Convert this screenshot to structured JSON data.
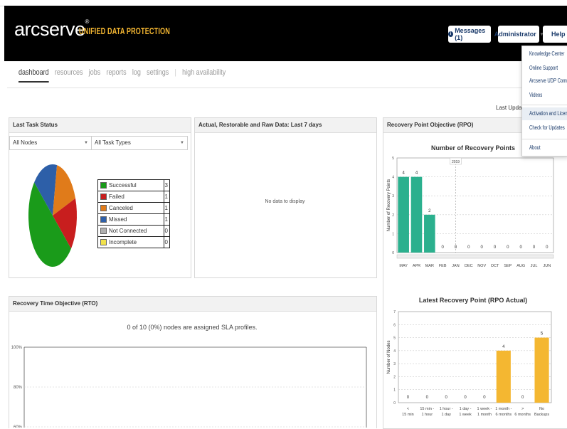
{
  "brand": {
    "logo": "arcserve",
    "reg": "®",
    "subtitle": "UNIFIED DATA PROTECTION"
  },
  "header": {
    "messages": "Messages (1)",
    "messages_icon": "info-icon",
    "admin": "Administrator",
    "help": "Help"
  },
  "nav": {
    "items": [
      "dashboard",
      "resources",
      "jobs",
      "reports",
      "log",
      "settings"
    ],
    "separator": "|",
    "extra": "high availability",
    "active": "dashboard"
  },
  "last_updated": "Last Updated:",
  "help_menu": {
    "items": [
      "Knowledge Center",
      "Online Support",
      "Arcserve UDP Commu",
      "Videos",
      "Activation and Licensing",
      "Check for Updates",
      "About"
    ],
    "highlighted": "Activation and Licensing"
  },
  "task_status": {
    "title": "Last Task Status",
    "node_filter": "All Nodes",
    "type_filter": "All Task Types",
    "legend": [
      {
        "label": "Successful",
        "count": "3",
        "color": "#1a9b1a"
      },
      {
        "label": "Failed",
        "count": "1",
        "color": "#c81e1e"
      },
      {
        "label": "Canceled",
        "count": "1",
        "color": "#e07b1a"
      },
      {
        "label": "Missed",
        "count": "1",
        "color": "#2d5fa8"
      },
      {
        "label": "Not Connected",
        "count": "0",
        "color": "#b0b0b0"
      },
      {
        "label": "Incomplete",
        "count": "0",
        "color": "#f1e24c"
      }
    ]
  },
  "data_panel": {
    "title": "Actual, Restorable and Raw Data: Last 7 days",
    "empty": "No data to display"
  },
  "rpo_panel": {
    "title": "Recovery Point Objective (RPO)"
  },
  "rto_panel": {
    "title": "Recovery Time Objective (RTO)",
    "sla_text": "0 of 10 (0%) nodes are assigned SLA profiles.",
    "ticks": [
      "100%",
      "80%",
      "60%"
    ]
  },
  "chart_data": [
    {
      "type": "bar",
      "title": "Number of Recovery Points",
      "ylabel": "Number of Recovery Points",
      "categories": [
        "MAY",
        "APR",
        "MAR",
        "FEB",
        "JAN",
        "DEC",
        "NOV",
        "OCT",
        "SEP",
        "AUG",
        "JUL",
        "JUN"
      ],
      "values": [
        4,
        4,
        2,
        0,
        0,
        0,
        0,
        0,
        0,
        0,
        0,
        0
      ],
      "ylim": [
        0,
        5
      ],
      "annotation": "2019",
      "color": "#2bb08e"
    },
    {
      "type": "bar",
      "title": "Latest Recovery Point (RPO Actual)",
      "ylabel": "Number of Nodes",
      "categories": [
        "< 15 min",
        "15 min - 1 hour",
        "1 hour - 1 day",
        "1 day - 1 week",
        "1 week - 1 month",
        "1 month - 6 months",
        "> 6 months",
        "No Backups"
      ],
      "values": [
        0,
        0,
        0,
        0,
        0,
        4,
        0,
        5
      ],
      "ylim": [
        0,
        7
      ],
      "color": "#f4b731"
    },
    {
      "type": "pie",
      "title": "",
      "categories": [
        "Successful",
        "Failed",
        "Canceled",
        "Missed",
        "Not Connected",
        "Incomplete"
      ],
      "values": [
        3,
        1,
        1,
        1,
        0,
        0
      ]
    }
  ]
}
